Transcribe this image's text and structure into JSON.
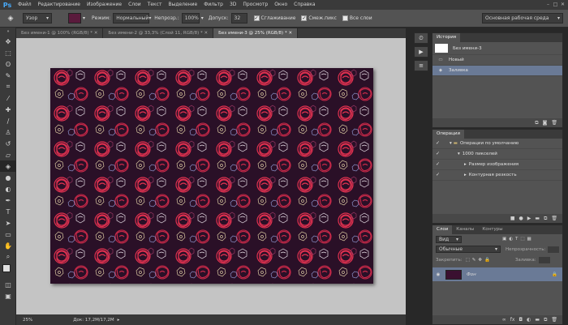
{
  "app": {
    "logo": "Ps"
  },
  "menu": [
    "Файл",
    "Редактирование",
    "Изображение",
    "Слои",
    "Текст",
    "Выделение",
    "Фильтр",
    "3D",
    "Просмотр",
    "Окно",
    "Справка"
  ],
  "options": {
    "tolerance_mode": "Узор",
    "mode_label": "Режим:",
    "mode_value": "Нормальный",
    "opacity_label": "Непрозр.:",
    "opacity_value": "100%",
    "tolerance_label": "Допуск:",
    "tolerance_value": "32",
    "antialias": "Сглаживание",
    "contiguous": "Смеж.пикс",
    "all_layers": "Все слои",
    "workspace": "Основная рабочая среда"
  },
  "tabs": [
    {
      "label": "Без имени-1 @ 100% (RGB/8) *"
    },
    {
      "label": "Без имени-2 @ 33,3% (Слой 11, RGB/8) *"
    },
    {
      "label": "Без имени-3 @ 25% (RGB/8) *"
    }
  ],
  "status": {
    "zoom": "25%",
    "doc": "Док: 17,2M/17,2M"
  },
  "history": {
    "tab": "История",
    "items": [
      {
        "label": "Без имени-3"
      },
      {
        "label": "Новый"
      },
      {
        "label": "Заливка"
      }
    ]
  },
  "actions": {
    "tab": "Операции",
    "items": [
      {
        "label": "Операции по умолчанию"
      },
      {
        "label": "1000 пикселей"
      },
      {
        "label": "Размер изображения"
      },
      {
        "label": "Контурная резкость"
      }
    ]
  },
  "layers": {
    "tabs": [
      "Слои",
      "Каналы",
      "Контуры"
    ],
    "kind": "Вид",
    "blend": "Обычные",
    "opacity_label": "Непрозрачность:",
    "lock_label": "Закрепить:",
    "fill_label": "Заливка:",
    "layer_name": "Фон"
  }
}
